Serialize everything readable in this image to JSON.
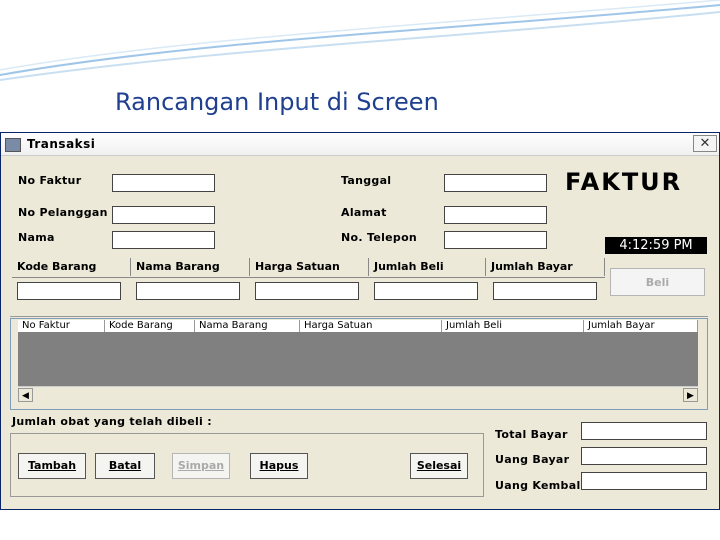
{
  "slide": {
    "title": "Rancangan Input di Screen"
  },
  "window": {
    "title": "Transaksi",
    "close_label": "✕"
  },
  "form": {
    "no_faktur_label": "No Faktur",
    "no_pelanggan_label": "No Pelanggan",
    "nama_label": "Nama",
    "tanggal_label": "Tanggal",
    "alamat_label": "Alamat",
    "telepon_label": "No. Telepon",
    "faktur_heading": "FAKTUR",
    "clock": "4:12:59 PM"
  },
  "entry_columns": [
    "Kode Barang",
    "Nama Barang",
    "Harga Satuan",
    "Jumlah Beli",
    "Jumlah Bayar"
  ],
  "beli_button": "Beli",
  "grid_columns": [
    "No Faktur",
    "Kode Barang",
    "Nama Barang",
    "Harga Satuan",
    "Jumlah Beli",
    "Jumlah Bayar"
  ],
  "summary": {
    "count_label": "Jumlah obat yang telah dibeli :",
    "total_label": "Total Bayar",
    "uang_bayar_label": "Uang Bayar",
    "uang_kembali_label": "Uang Kembali"
  },
  "buttons": {
    "tambah": "Tambah",
    "batal": "Batal",
    "simpan": "Simpan",
    "hapus": "Hapus",
    "selesai": "Selesai"
  },
  "colors": {
    "title_blue": "#1f3f8f",
    "window_bg": "#ece9d8",
    "grid_gray": "#808080"
  }
}
